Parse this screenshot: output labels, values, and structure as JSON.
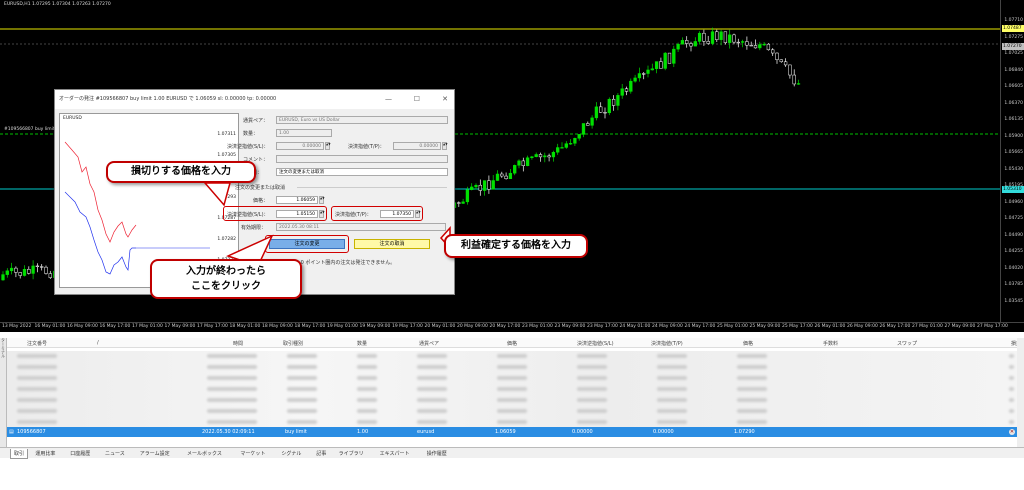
{
  "chart": {
    "title": "EURUSD,H1  1.07295 1.07304 1.07263 1.07270",
    "order_line_label": "#109566807 buy limit",
    "price_labels": [
      "1.07710",
      "1.07275",
      "1.07025",
      "1.06840",
      "1.06605",
      "1.06370",
      "1.06135",
      "1.05900",
      "1.05665",
      "1.05430",
      "1.05195",
      "1.04960",
      "1.04725",
      "1.04490",
      "1.04255",
      "1.04020",
      "1.03785",
      "1.03545"
    ],
    "price_tags": [
      {
        "text": "1.07487",
        "color": "#ffff66"
      },
      {
        "text": "1.07270",
        "color": "#c0c0c0"
      },
      {
        "text": "1.05310",
        "color": "#33dddd"
      }
    ],
    "time_labels": [
      "13 May 2022",
      "16 May 01:00",
      "16 May 09:00",
      "16 May 17:00",
      "17 May 01:00",
      "17 May 09:00",
      "17 May 17:00",
      "18 May 01:00",
      "18 May 09:00",
      "18 May 17:00",
      "19 May 01:00",
      "19 May 09:00",
      "19 May 17:00",
      "20 May 01:00",
      "20 May 09:00",
      "20 May 17:00",
      "23 May 01:00",
      "23 May 09:00",
      "23 May 17:00",
      "24 May 01:00",
      "24 May 09:00",
      "24 May 17:00",
      "25 May 01:00",
      "25 May 09:00",
      "25 May 17:00",
      "26 May 01:00",
      "26 May 09:00",
      "26 May 17:00",
      "27 May 01:00",
      "27 May 09:00",
      "27 May 17:00"
    ]
  },
  "dialog": {
    "title": "オーダーの発注  #109566807 buy limit 1.00 EURUSD で 1.06059 sl: 0.00000 tp: 0.00000",
    "mini_chart": {
      "title": "EURUSD",
      "prices": [
        "1.07311",
        "1.07305",
        "1.07299",
        "1.07293",
        "1.07287",
        "1.07282",
        "1.07277",
        "1.07270"
      ]
    },
    "symbol_label": "通貨ペア：",
    "symbol_value": "EURUSD, Euro vs US Dollar",
    "volume_label": "数量：",
    "volume_value": "1.00",
    "sl_label_top": "決済逆指値(S/L)：",
    "sl_value_top": "0.00000",
    "tp_label_top": "決済指値(T/P)：",
    "tp_value_top": "0.00000",
    "comment_label": "コメント：",
    "type_label": "注文種別：",
    "type_value": "注文の変更または取消",
    "section_label": "注文の変更または取消",
    "price_label": "価格：",
    "price_value": "1.06059",
    "sl_label": "決済逆指値(S/L)：",
    "sl_value": "1.05150",
    "tp_label": "決済指値(T/P)：",
    "tp_value": "1.07350",
    "expiry_label": "有効期限：",
    "expiry_value": "2022.05.30 08:11",
    "modify_button": "注文の変更",
    "cancel_button": "注文の取消",
    "note": "現在価格から 0 ポイント圏内の注文は発注できません。"
  },
  "callouts": {
    "sl": "損切りする価格を入力",
    "tp": "利益確定する価格を入力",
    "click_line1": "入力が終わったら",
    "click_line2": "ここをクリック"
  },
  "table": {
    "headers": [
      "注文番号",
      "/",
      "時間",
      "取引種別",
      "数量",
      "通貨ペア",
      "価格",
      "決済逆指値(S/L)",
      "決済指値(T/P)",
      "価格",
      "手数料",
      "スワップ",
      "損益"
    ],
    "selected_row": {
      "order": "109566807",
      "time": "2022.05.30 02:09:11",
      "type": "buy limit",
      "volume": "1.00",
      "symbol": "eurusd",
      "price": "1.06059",
      "sl": "0.00000",
      "tp": "0.00000",
      "current": "1.07290"
    }
  },
  "terminal_label": "ターミナル",
  "tabs": [
    "取引",
    "運用比率",
    "口座履歴",
    "ニュース",
    "アラーム設定",
    "メールボックス",
    "マーケット",
    "シグナル",
    "記事",
    "ライブラリ",
    "エキスパート",
    "操作履歴"
  ]
}
